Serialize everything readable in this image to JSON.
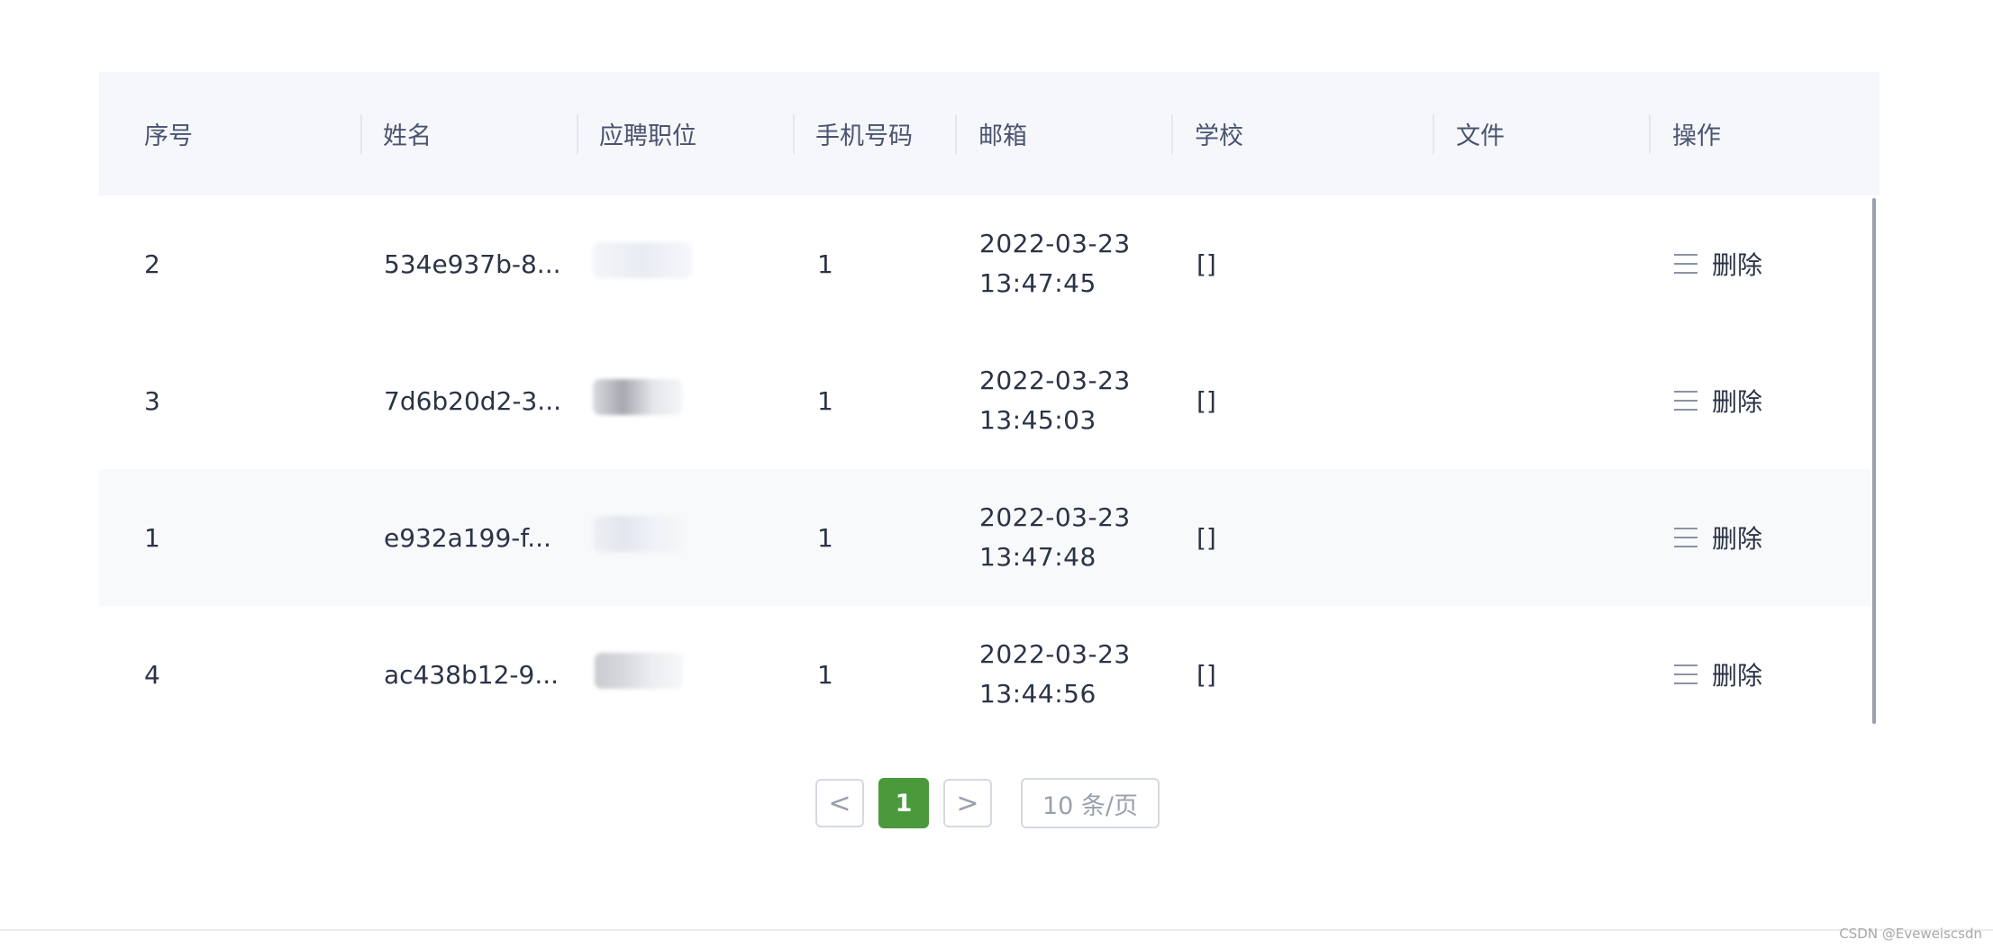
{
  "table": {
    "headers": [
      "序号",
      "姓名",
      "应聘职位",
      "手机号码",
      "邮箱",
      "学校",
      "文件",
      "操作"
    ],
    "rows": [
      {
        "index": "2",
        "name": "534e937b-8...",
        "phone": "1",
        "date": "2022-03-23",
        "time": "13:47:45",
        "school": "[]",
        "action": "删除"
      },
      {
        "index": "3",
        "name": "7d6b20d2-3...",
        "phone": "1",
        "date": "2022-03-23",
        "time": "13:45:03",
        "school": "[]",
        "action": "删除"
      },
      {
        "index": "1",
        "name": "e932a199-f...",
        "phone": "1",
        "date": "2022-03-23",
        "time": "13:47:48",
        "school": "[]",
        "action": "删除"
      },
      {
        "index": "4",
        "name": "ac438b12-9...",
        "phone": "1",
        "date": "2022-03-23",
        "time": "13:44:56",
        "school": "[]",
        "action": "删除"
      }
    ]
  },
  "pagination": {
    "prev": "<",
    "current": "1",
    "next": ">",
    "page_size": "10 条/页"
  },
  "watermark": "CSDN @Eveweiscsdn",
  "colors": {
    "header_bg": "#f5f7fb",
    "row_striped_bg": "#f8f9fa",
    "accent_green": "#4a9a3c"
  }
}
